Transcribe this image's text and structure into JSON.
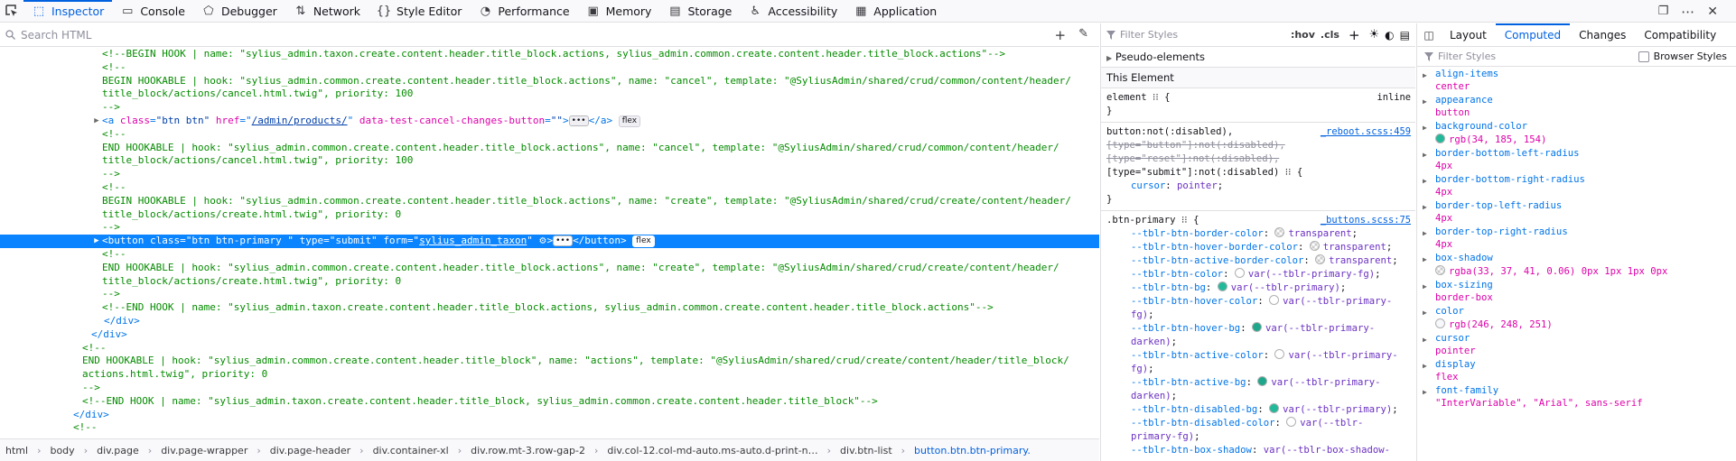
{
  "toolbar": {
    "tabs": [
      {
        "label": "Inspector",
        "icon": "inspector-icon"
      },
      {
        "label": "Console",
        "icon": "console-icon"
      },
      {
        "label": "Debugger",
        "icon": "debugger-icon"
      },
      {
        "label": "Network",
        "icon": "network-icon"
      },
      {
        "label": "Style Editor",
        "icon": "style-editor-icon"
      },
      {
        "label": "Performance",
        "icon": "performance-icon"
      },
      {
        "label": "Memory",
        "icon": "memory-icon"
      },
      {
        "label": "Storage",
        "icon": "storage-icon"
      },
      {
        "label": "Accessibility",
        "icon": "accessibility-icon"
      },
      {
        "label": "Application",
        "icon": "application-icon"
      }
    ],
    "selected_tab": "Inspector"
  },
  "markup": {
    "search_placeholder": "Search HTML",
    "lines": {
      "l1": "<!--BEGIN HOOK | name: \"sylius_admin.taxon.create.content.header.title_block.actions, sylius_admin.common.create.content.header.title_block.actions\"-->",
      "l2": "<!--",
      "l3": "BEGIN HOOKABLE | hook: \"sylius_admin.common.create.content.header.title_block.actions\", name: \"cancel\", template: \"@SyliusAdmin/shared/crud/common/content/header/",
      "l4": "title_block/actions/cancel.html.twig\", priority: 100",
      "l5": "-->",
      "l6_tag_open": "<a",
      "l6_attr1": "class",
      "l6_val1": "\"btn btn\"",
      "l6_attr2": "href",
      "l6_val2": "/admin/products/",
      "l6_attr3": "data-test-cancel-changes-button",
      "l6_val3": "\"\"",
      "l6_close": "</a>",
      "l6_badge": "flex",
      "l7": "<!--",
      "l8": "END HOOKABLE | hook: \"sylius_admin.common.create.content.header.title_block.actions\", name: \"cancel\", template: \"@SyliusAdmin/shared/crud/common/content/header/",
      "l9": "title_block/actions/cancel.html.twig\", priority: 100",
      "l10": "-->",
      "l11": "<!--",
      "l12": "BEGIN HOOKABLE | hook: \"sylius_admin.common.create.content.header.title_block.actions\", name: \"create\", template: \"@SyliusAdmin/shared/crud/create/content/header/",
      "l13": "title_block/actions/create.html.twig\", priority: 0",
      "l14": "-->",
      "l15_tag_open": "<button",
      "l15_attr1": "class",
      "l15_val1": "\"btn btn-primary \"",
      "l15_attr2": "type",
      "l15_val2": "\"submit\"",
      "l15_attr3": "form",
      "l15_val3": "sylius_admin_taxon",
      "l15_close": "</button>",
      "l15_badge": "flex",
      "l16": "<!--",
      "l17": "END HOOKABLE | hook: \"sylius_admin.common.create.content.header.title_block.actions\", name: \"create\", template: \"@SyliusAdmin/shared/crud/create/content/header/",
      "l18": "title_block/actions/create.html.twig\", priority: 0",
      "l19": "-->",
      "l20": "<!--END HOOK | name: \"sylius_admin.taxon.create.content.header.title_block.actions, sylius_admin.common.create.content.header.title_block.actions\"-->",
      "l21": "</div>",
      "l22": "</div>",
      "l23": "<!--",
      "l24": "END HOOKABLE | hook: \"sylius_admin.common.create.content.header.title_block\", name: \"actions\", template: \"@SyliusAdmin/shared/crud/create/content/header/title_block/",
      "l25": "actions.html.twig\", priority: 0",
      "l26": "-->",
      "l27": "<!--END HOOK | name: \"sylius_admin.taxon.create.content.header.title_block, sylius_admin.common.create.content.header.title_block\"-->",
      "l28": "</div>",
      "l29": "<!--"
    },
    "breadcrumbs": [
      {
        "tag": "html",
        "rest": ""
      },
      {
        "tag": "body",
        "rest": ""
      },
      {
        "tag": "div",
        "rest": ".page"
      },
      {
        "tag": "div",
        "rest": ".page-wrapper"
      },
      {
        "tag": "div",
        "rest": ".page-header"
      },
      {
        "tag": "div",
        "rest": ".container-xl"
      },
      {
        "tag": "div",
        "rest": ".row.mt-3.row-gap-2"
      },
      {
        "tag": "div",
        "rest": ".col-12.col-md-auto.ms-auto.d-print-n…"
      },
      {
        "tag": "div",
        "rest": ".btn-list"
      },
      {
        "tag": "button",
        "rest": ".btn.btn-primary."
      }
    ]
  },
  "rules": {
    "filter_placeholder": "Filter Styles",
    "hov": ":hov",
    "cls": ".cls",
    "pseudo_label": "Pseudo-elements",
    "this_element_label": "This Element",
    "element_rule": {
      "selector": "element",
      "source": "inline"
    },
    "rule1": {
      "sel1": "button:not(:disabled),",
      "sel2": "[type=\"button\"]:not(:disabled),",
      "sel3": "[type=\"reset\"]:not(:disabled),",
      "sel4": "[type=\"submit\"]:not(:disabled)",
      "source": "_reboot.scss:459",
      "prop": "cursor",
      "val": "pointer"
    },
    "rule2": {
      "selector": ".btn-primary",
      "source": "_buttons.scss:75",
      "decls": [
        {
          "p": "--tblr-btn-border-color",
          "v": "transparent",
          "sw": "transparent"
        },
        {
          "p": "--tblr-btn-hover-border-color",
          "v": "transparent",
          "sw": "transparent"
        },
        {
          "p": "--tblr-btn-active-border-color",
          "v": "transparent",
          "sw": "transparent"
        },
        {
          "p": "--tblr-btn-color",
          "v": "var(--tblr-primary-fg)",
          "sw": "#ffffff"
        },
        {
          "p": "--tblr-btn-bg",
          "v": "var(--tblr-primary)",
          "sw": "#22b99a"
        },
        {
          "p": "--tblr-btn-hover-color",
          "v": "var(--tblr-primary-",
          "v2": "fg)",
          "sw": "#ffffff"
        },
        {
          "p": "--tblr-btn-hover-bg",
          "v": "var(--tblr-primary-",
          "v2": "darken)",
          "sw": "#1fa78b"
        },
        {
          "p": "--tblr-btn-active-color",
          "v": "var(--tblr-primary-",
          "v2": "fg)",
          "sw": "#ffffff"
        },
        {
          "p": "--tblr-btn-active-bg",
          "v": "var(--tblr-primary-",
          "v2": "darken)",
          "sw": "#1fa78b"
        },
        {
          "p": "--tblr-btn-disabled-bg",
          "v": "var(--tblr-primary)",
          "sw": "#22b99a"
        },
        {
          "p": "--tblr-btn-disabled-color",
          "v": "var(--tblr-",
          "v2": "primary-fg)",
          "sw": "#ffffff"
        },
        {
          "p": "--tblr-btn-box-shadow",
          "v": "var(--tblr-box-shadow-",
          "v2": ""
        }
      ]
    }
  },
  "computed": {
    "tabs": [
      "Layout",
      "Computed",
      "Changes",
      "Compatibility"
    ],
    "selected_tab": "Computed",
    "filter_placeholder": "Filter Styles",
    "browser_styles_label": "Browser Styles",
    "props": [
      {
        "n": "align-items",
        "v": "center"
      },
      {
        "n": "appearance",
        "v": "button"
      },
      {
        "n": "background-color",
        "v": "rgb(34, 185, 154)",
        "sw": "#22b99a"
      },
      {
        "n": "border-bottom-left-radius",
        "v": "4px"
      },
      {
        "n": "border-bottom-right-radius",
        "v": "4px"
      },
      {
        "n": "border-top-left-radius",
        "v": "4px"
      },
      {
        "n": "border-top-right-radius",
        "v": "4px"
      },
      {
        "n": "box-shadow",
        "v": "rgba(33, 37, 41, 0.06) 0px 1px 1px 0px",
        "sw": "transparent"
      },
      {
        "n": "box-sizing",
        "v": "border-box"
      },
      {
        "n": "color",
        "v": "rgb(246, 248, 251)",
        "sw": "#f6f8fb"
      },
      {
        "n": "cursor",
        "v": "pointer"
      },
      {
        "n": "display",
        "v": "flex"
      },
      {
        "n": "font-family",
        "v": "\"InterVariable\", \"Arial\", sans-serif"
      }
    ]
  }
}
